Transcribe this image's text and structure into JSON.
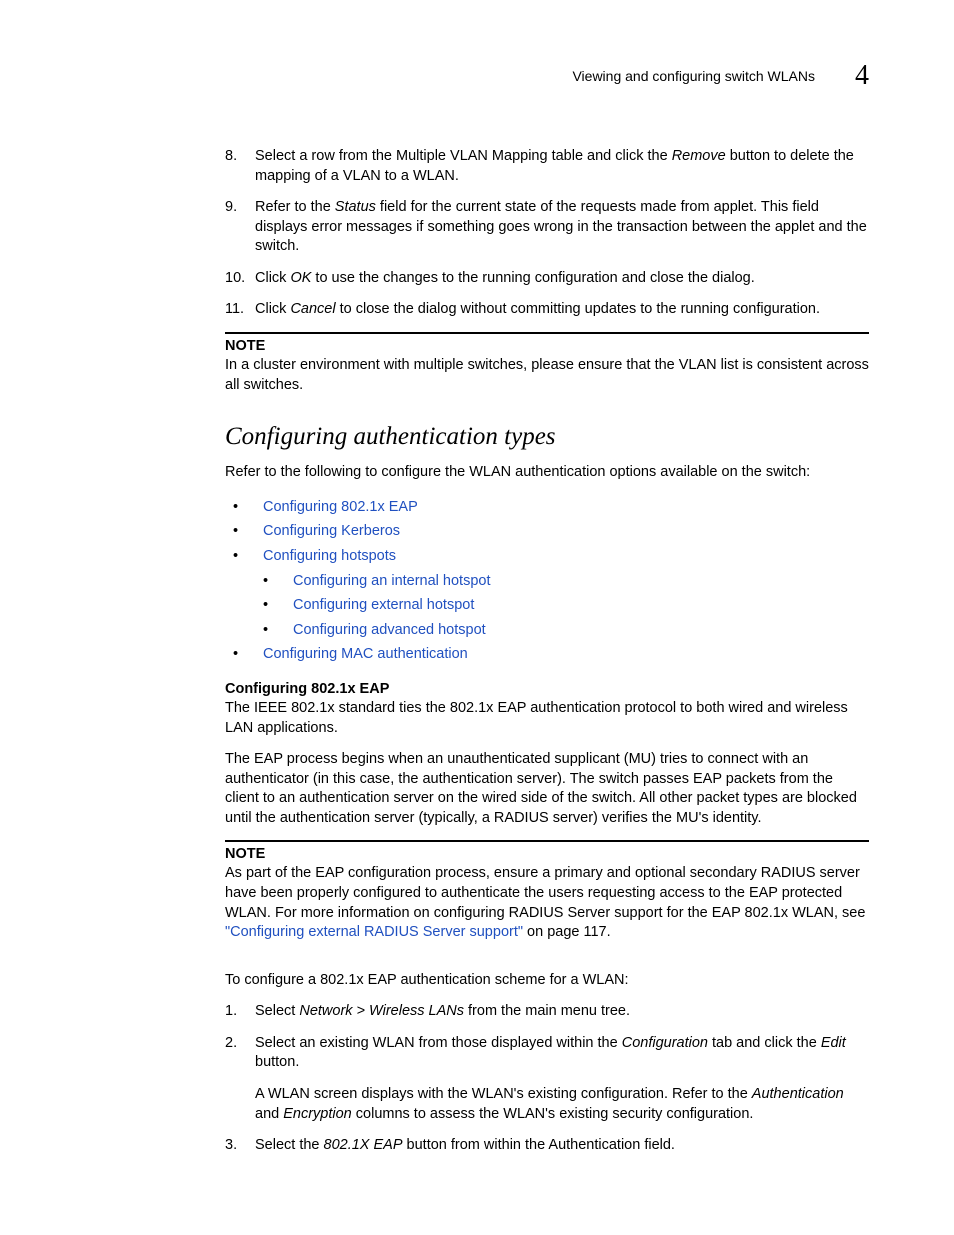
{
  "header": {
    "title": "Viewing and configuring switch WLANs",
    "chapter_number": "4"
  },
  "steps_a": [
    {
      "num": "8.",
      "parts": [
        "Select a row from the Multiple VLAN Mapping table and click the ",
        {
          "i": "Remove"
        },
        " button to delete the mapping of a VLAN to a WLAN."
      ]
    },
    {
      "num": "9.",
      "parts": [
        "Refer to the ",
        {
          "i": "Status"
        },
        " field for the current state of the requests made from applet. This field displays error messages if something goes wrong in the transaction between the applet and the switch."
      ]
    },
    {
      "num": "10.",
      "parts": [
        "Click ",
        {
          "i": "OK"
        },
        " to use the changes to the running configuration and close the dialog."
      ]
    },
    {
      "num": "11.",
      "parts": [
        "Click ",
        {
          "i": "Cancel"
        },
        " to close the dialog without committing updates to the running configuration."
      ]
    }
  ],
  "note1": {
    "label": "NOTE",
    "body": "In a cluster environment with multiple switches, please ensure that the VLAN list is consistent across all switches."
  },
  "section_heading": "Configuring authentication types",
  "intro_para": "Refer to the following to configure the WLAN authentication options available on the switch:",
  "links": {
    "l1": "Configuring 802.1x EAP",
    "l2": "Configuring Kerberos",
    "l3": "Configuring hotspots",
    "l3a": "Configuring an internal hotspot",
    "l3b": "Configuring external hotspot",
    "l3c": "Configuring advanced hotspot",
    "l4": "Configuring MAC authentication"
  },
  "subheading": "Configuring 802.1x EAP",
  "para1": "The IEEE 802.1x standard ties the 802.1x EAP authentication protocol to both wired and wireless LAN applications.",
  "para2": "The EAP process begins when an unauthenticated supplicant (MU) tries to connect with an authenticator (in this case, the authentication server). The switch passes EAP packets from the client to an authentication server on the wired side of the switch. All other packet types are blocked until the authentication server (typically, a RADIUS server) verifies the MU's identity.",
  "note2": {
    "label": "NOTE",
    "body_pre": "As part of the EAP configuration process, ensure a primary and optional secondary RADIUS server have been properly configured to authenticate the users requesting access to the EAP protected WLAN. For more information on configuring RADIUS Server support for the EAP 802.1x WLAN, see ",
    "link": "\"Configuring external RADIUS Server support\"",
    "body_post": " on page 117."
  },
  "para3": "To configure a 802.1x EAP authentication scheme for a WLAN:",
  "steps_b": [
    {
      "num": "1.",
      "parts": [
        "Select ",
        {
          "i": "Network > Wireless LANs"
        },
        " from the main menu tree."
      ]
    },
    {
      "num": "2.",
      "parts": [
        "Select an existing WLAN from those displayed within the ",
        {
          "i": "Configuration"
        },
        " tab and click the ",
        {
          "i": "Edit"
        },
        " button."
      ],
      "sub": [
        "A WLAN screen displays with the WLAN's existing configuration. Refer to the ",
        {
          "i": "Authentication"
        },
        " and ",
        {
          "i": "Encryption"
        },
        " columns to assess the WLAN's existing security configuration."
      ]
    },
    {
      "num": "3.",
      "parts": [
        "Select the ",
        {
          "i": "802.1X EAP"
        },
        " button from within the Authentication field."
      ]
    }
  ]
}
